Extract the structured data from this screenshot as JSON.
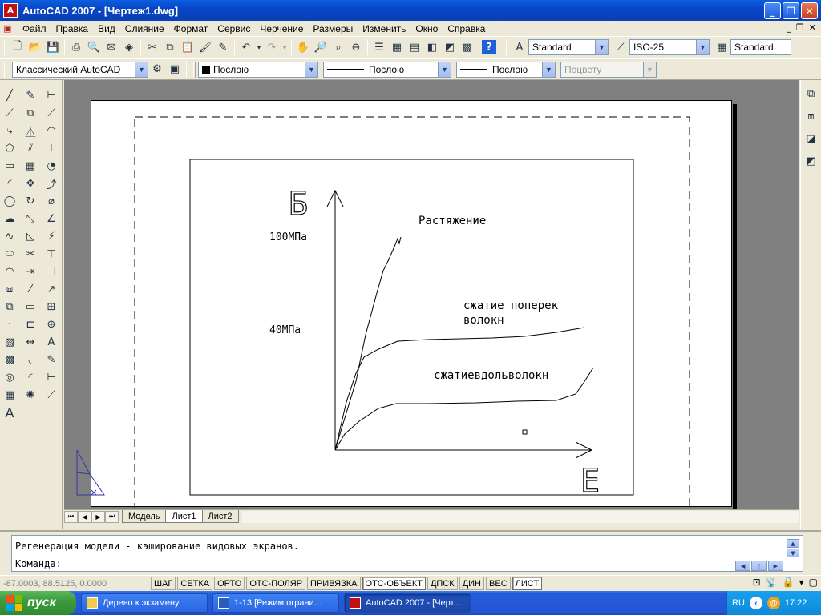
{
  "window": {
    "title": "AutoCAD 2007 - [Чертеж1.dwg]",
    "icon": "autocad-app-icon"
  },
  "menu": [
    "Файл",
    "Правка",
    "Вид",
    "Слияние",
    "Формат",
    "Сервис",
    "Черчение",
    "Размеры",
    "Изменить",
    "Окно",
    "Справка"
  ],
  "toolbar": {
    "text_style": "Standard",
    "dim_style": "ISO-25",
    "table_style": "Standard",
    "workspace": "Классический AutoCAD",
    "layer": "Послою",
    "linetype": "Послою",
    "lineweight": "Послою",
    "plotstyle": "Поцвету"
  },
  "drawing": {
    "sigma_label": "Б",
    "epsilon_label": "Е",
    "label_100": "100МПа",
    "label_40": "40МПа",
    "curve_tension": "Растяжение",
    "curve_cross_line1": "сжатие поперек",
    "curve_cross_line2": "волокн",
    "curve_along": "сжатиевдольволокн"
  },
  "tabs": [
    "Модель",
    "Лист1",
    "Лист2"
  ],
  "active_tab": "Лист1",
  "command": {
    "history": "Регенерация модели - кэширование видовых экранов.",
    "prompt": "Команда:"
  },
  "status": {
    "coords": "-87.0003, 88.5125, 0.0000",
    "buttons": [
      {
        "label": "ШАГ",
        "on": false
      },
      {
        "label": "СЕТКА",
        "on": false
      },
      {
        "label": "ОРТО",
        "on": false
      },
      {
        "label": "ОТС-ПОЛЯР",
        "on": false
      },
      {
        "label": "ПРИВЯЗКА",
        "on": false
      },
      {
        "label": "ОТС-ОБЪЕКТ",
        "on": true
      },
      {
        "label": "ДПСК",
        "on": false
      },
      {
        "label": "ДИН",
        "on": false
      },
      {
        "label": "ВЕС",
        "on": false
      },
      {
        "label": "ЛИСТ",
        "on": true
      }
    ]
  },
  "taskbar": {
    "start": "пуск",
    "items": [
      {
        "label": "Дерево к экзамену",
        "active": false
      },
      {
        "label": "1-13 [Режим ограни...",
        "active": false
      },
      {
        "label": "AutoCAD 2007 - [Черт...",
        "active": true
      }
    ],
    "lang": "RU",
    "clock": "17:22"
  },
  "colors": {
    "titlebar": "#0846c6",
    "taskbar": "#245ddb",
    "start": "#3c9b3c",
    "paper": "#ffffff",
    "workspace": "#808080"
  }
}
